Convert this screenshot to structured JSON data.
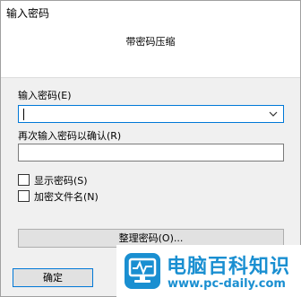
{
  "window": {
    "title": "输入密码",
    "subtitle": "带密码压缩"
  },
  "form": {
    "password_label": "输入密码(E)",
    "password_value": "",
    "confirm_label": "再次输入密码以确认(R)",
    "confirm_value": "",
    "show_password_label": "显示密码(S)",
    "show_password_checked": false,
    "encrypt_filenames_label": "加密文件名(N)",
    "encrypt_filenames_checked": false,
    "organize_button": "整理密码(O)..."
  },
  "buttons": {
    "ok": "确定"
  },
  "watermark": {
    "title": "电脑百科知识",
    "url": "www.pc-daily.com",
    "color": "#1a8fd1"
  }
}
